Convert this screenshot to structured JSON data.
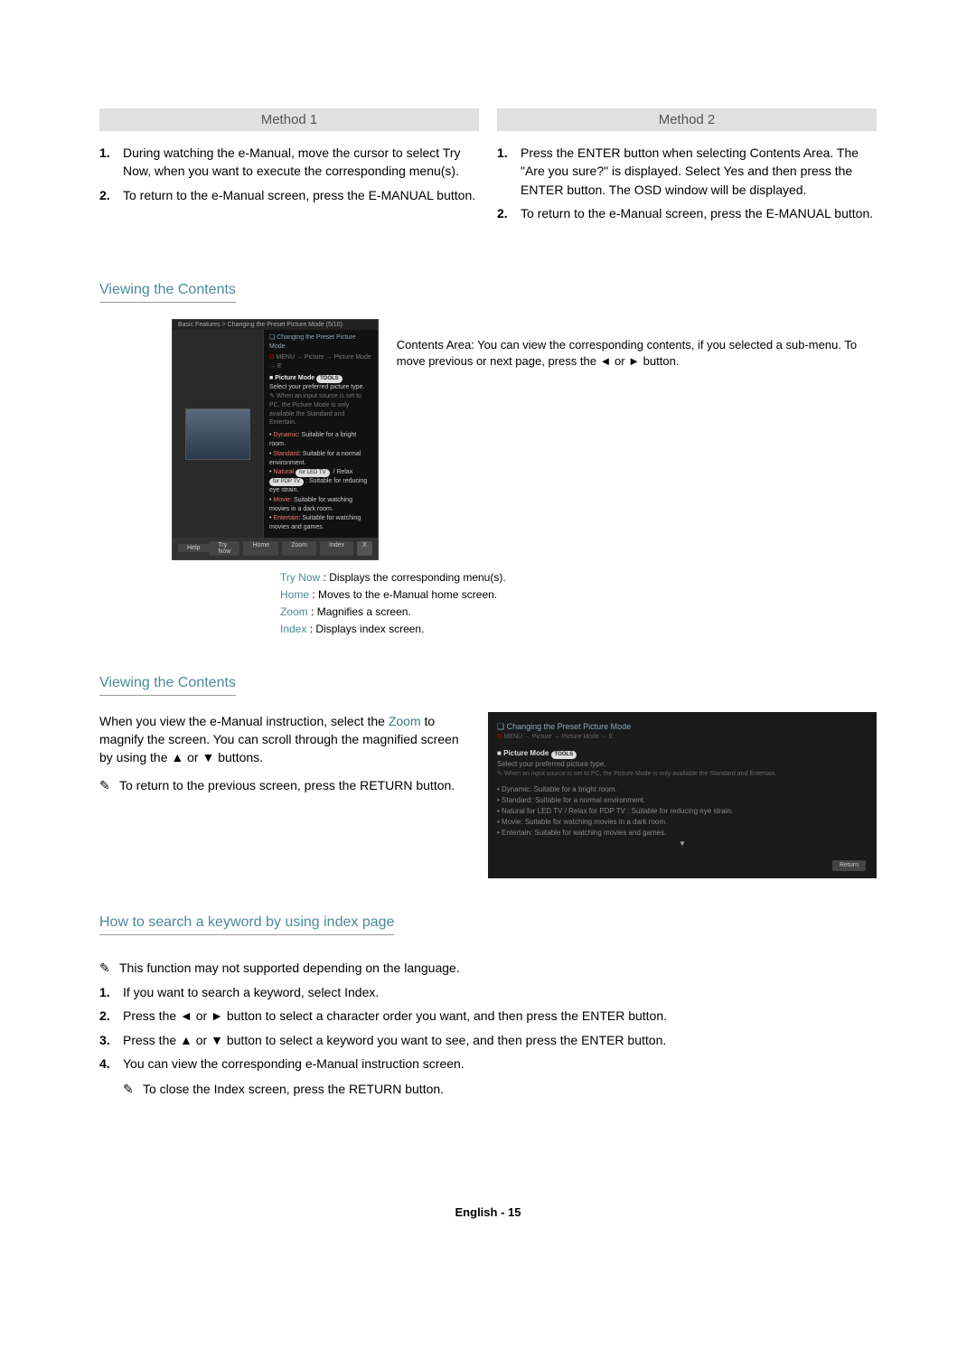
{
  "method1": {
    "header": "Method 1",
    "steps": [
      "During watching the e-Manual, move the cursor to select Try Now, when you want to execute the corresponding menu(s).",
      "To return to the e-Manual screen, press the E-MANUAL button."
    ]
  },
  "method2": {
    "header": "Method 2",
    "steps": [
      "Press the ENTER button when selecting Contents Area. The \"Are you sure?\" is displayed. Select Yes and then press the ENTER button. The OSD window will be displayed.",
      "To return to the e-Manual screen, press the E-MANUAL button."
    ]
  },
  "viewing1": {
    "title": "Viewing the Contents",
    "contents_desc": "Contents Area: You can view the corresponding contents, if you selected a sub-menu. To move previous or next page, press the ◄ or ► button.",
    "legend": [
      {
        "label": "Try Now",
        "desc": ": Displays the corresponding menu(s)."
      },
      {
        "label": "Home",
        "desc": ": Moves to the e-Manual home screen."
      },
      {
        "label": "Zoom",
        "desc": ": Magnifies a screen."
      },
      {
        "label": "Index",
        "desc": ": Displays index screen."
      }
    ]
  },
  "screenshot1": {
    "breadcrumb": "Basic Features > Changing the Preset Picture Mode (5/10)",
    "heading": "Changing the Preset Picture Mode",
    "menupath": "MENU → Picture → Picture Mode → E",
    "section": "Picture Mode",
    "tools": "TOOLS",
    "intro": "Select your preferred picture type.",
    "note": "When an input source is set to PC, the Picture Mode is only available the Standard and Entertain.",
    "bullets": [
      {
        "name": "Dynamic",
        "desc": "Suitable for a bright room."
      },
      {
        "name": "Standard",
        "desc": "Suitable for a normal environment."
      },
      {
        "name": "Natural",
        "desc": "Suitable for reducing eye strain."
      },
      {
        "name": "Movie",
        "desc": "Suitable for watching movies in a dark room."
      },
      {
        "name": "Entertain",
        "desc": "Suitable for watching movies and games."
      }
    ],
    "pill_led": "for LED TV",
    "pill_pdp": "for PDP TV",
    "footer": {
      "help": "Help",
      "try_now": "Try Now",
      "home": "Home",
      "zoom": "Zoom",
      "index": "Index",
      "close": "X"
    }
  },
  "viewing2": {
    "title": "Viewing the Contents",
    "text1": "When you view the e-Manual instruction, select the",
    "zoom": "Zoom",
    "text2": "to magnify the screen. You can scroll through the magnified screen by using the",
    "text3_tail": "buttons.",
    "note": "To return to the previous screen, press the RETURN button."
  },
  "screenshot2": {
    "heading": "Changing the Preset Picture Mode",
    "menupath": "MENU → Picture → Picture Mode → E",
    "section": "Picture Mode",
    "tools": "TOOLS",
    "intro": "Select your preferred picture type.",
    "note": "When an input source is set to PC, the Picture Mode is only available the Standard and Entertain.",
    "lines": [
      "Dynamic: Suitable for a bright room.",
      "Standard: Suitable for a normal environment.",
      "Natural for LED TV / Relax for PDP TV : Suitable for reducing eye strain.",
      "Movie: Suitable for watching movies in a dark room.",
      "Entertain: Suitable for watching movies and games."
    ],
    "return": "Return"
  },
  "search": {
    "title": "How to search a keyword by using index page",
    "note_top": "This function may not supported depending on the language.",
    "steps": [
      "If you want to search a keyword, select Index.",
      "Press the ◄ or ► button to select a character order you want, and then press the ENTER button.",
      "Press the ▲ or ▼ button to select a keyword you want to see, and then press the ENTER button.",
      "You can view the corresponding e-Manual instruction screen."
    ],
    "note_bottom": "To close the Index screen, press the RETURN button."
  },
  "footer": "English - 15"
}
